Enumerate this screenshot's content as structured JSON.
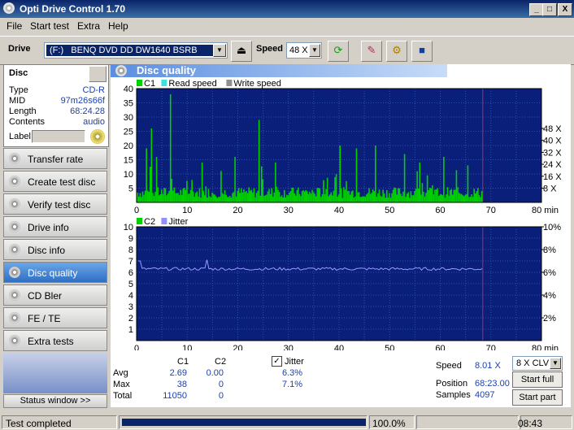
{
  "window": {
    "title": "Opti Drive Control 1.70",
    "min": "_",
    "max": "□",
    "close": "X"
  },
  "menu": [
    "File",
    "Start test",
    "Extra",
    "Help"
  ],
  "toolbar": {
    "drive_label": "Drive",
    "drive_value": "(F:)   BENQ DVD DD DW1640 BSRB",
    "speed_label": "Speed",
    "speed_value": "48 X"
  },
  "disc": {
    "header": "Disc",
    "rows": [
      {
        "k": "Type",
        "v": "CD-R"
      },
      {
        "k": "MID",
        "v": "97m26s66f"
      },
      {
        "k": "Length",
        "v": "68:24.28"
      },
      {
        "k": "Contents",
        "v": "audio"
      }
    ],
    "label_key": "Label"
  },
  "nav": [
    "Transfer rate",
    "Create test disc",
    "Verify test disc",
    "Drive info",
    "Disc info",
    "Disc quality",
    "CD Bler",
    "FE / TE",
    "Extra tests"
  ],
  "nav_active": 5,
  "status_window": "Status window >>",
  "panel_title": "Disc quality",
  "chart_data": [
    {
      "type": "bar",
      "legend": [
        "C1",
        "Read speed",
        "Write speed"
      ],
      "legend_colors": [
        "#00d000",
        "#40e0e0",
        "#909090"
      ],
      "x": [
        0,
        10,
        20,
        30,
        40,
        50,
        60,
        70,
        80
      ],
      "xlabel": "min",
      "ylim": [
        0,
        40
      ],
      "yticks": [
        5,
        10,
        15,
        20,
        25,
        30,
        35,
        40
      ],
      "y2ticks": [
        "8 X",
        "16 X",
        "24 X",
        "32 X",
        "40 X",
        "48 X"
      ],
      "data_end_min": 68.4,
      "baseline": 2.69,
      "spikes": [
        [
          6.8,
          38
        ],
        [
          3,
          26
        ],
        [
          2,
          19
        ],
        [
          24.3,
          29
        ],
        [
          4,
          16
        ],
        [
          13,
          14
        ],
        [
          19.6,
          16
        ],
        [
          27.6,
          14
        ],
        [
          40.2,
          20
        ],
        [
          43.5,
          19
        ],
        [
          47.2,
          20
        ],
        [
          53,
          17
        ],
        [
          56,
          14
        ],
        [
          60.7,
          16
        ],
        [
          65.5,
          13
        ]
      ]
    },
    {
      "type": "line",
      "legend": [
        "C2",
        "Jitter"
      ],
      "legend_colors": [
        "#00d000",
        "#9090ff"
      ],
      "x": [
        0,
        10,
        20,
        30,
        40,
        50,
        60,
        70,
        80
      ],
      "xlabel": "min",
      "ylim": [
        0,
        10
      ],
      "yticks": [
        1,
        2,
        3,
        4,
        5,
        6,
        7,
        8,
        9,
        10
      ],
      "y2ticks": [
        "2%",
        "4%",
        "6%",
        "8%",
        "10%"
      ],
      "jitter_avg_pct": 6.3,
      "data_end_min": 68.4
    }
  ],
  "stats": {
    "col_c1": "C1",
    "col_c2": "C2",
    "jitter_label": "Jitter",
    "rows": [
      {
        "k": "Avg",
        "c1": "2.69",
        "c2": "0.00",
        "j": "6.3%"
      },
      {
        "k": "Max",
        "c1": "38",
        "c2": "0",
        "j": "7.1%"
      },
      {
        "k": "Total",
        "c1": "11050",
        "c2": "0",
        "j": ""
      }
    ],
    "speed_label": "Speed",
    "speed_value": "8.01 X",
    "position_label": "Position",
    "position_value": "68:23.00",
    "samples_label": "Samples",
    "samples_value": "4097",
    "clv_value": "8 X CLV",
    "start_full": "Start full",
    "start_part": "Start part"
  },
  "status": {
    "text": "Test completed",
    "progress": 1.0,
    "percent": "100.0%",
    "time": "08:43"
  }
}
